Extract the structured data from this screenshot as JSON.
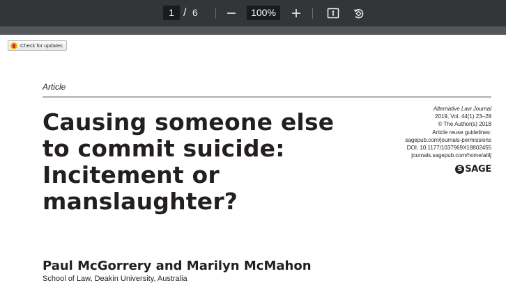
{
  "toolbar": {
    "page_current": "1",
    "page_separator": "/",
    "page_total": "6",
    "zoom_level": "100%",
    "icons": [
      "zoom-out-icon",
      "zoom-in-icon",
      "fit-page-icon",
      "rotate-icon"
    ]
  },
  "page": {
    "check_updates_label": "Check for updates",
    "article_type": "Article",
    "title_lines": [
      "Causing someone else",
      "to commit suicide:",
      "Incitement or",
      "manslaughter?"
    ],
    "meta": {
      "journal": "Alternative Law Journal",
      "volume": "2019, Vol. 44(1) 23–28",
      "copyright": "© The Author(s) 2018",
      "reuse": "Article reuse guidelines:",
      "permissions": "sagepub.com/journals-permissions",
      "doi": "DOI: 10.1177/1037969X18802455",
      "journal_url": "journals.sagepub.com/home/altlj"
    },
    "publisher_mark": "S",
    "publisher": "SAGE",
    "authors": "Paul McGorrery and Marilyn McMahon",
    "affiliation": "School of Law, Deakin University, Australia"
  }
}
